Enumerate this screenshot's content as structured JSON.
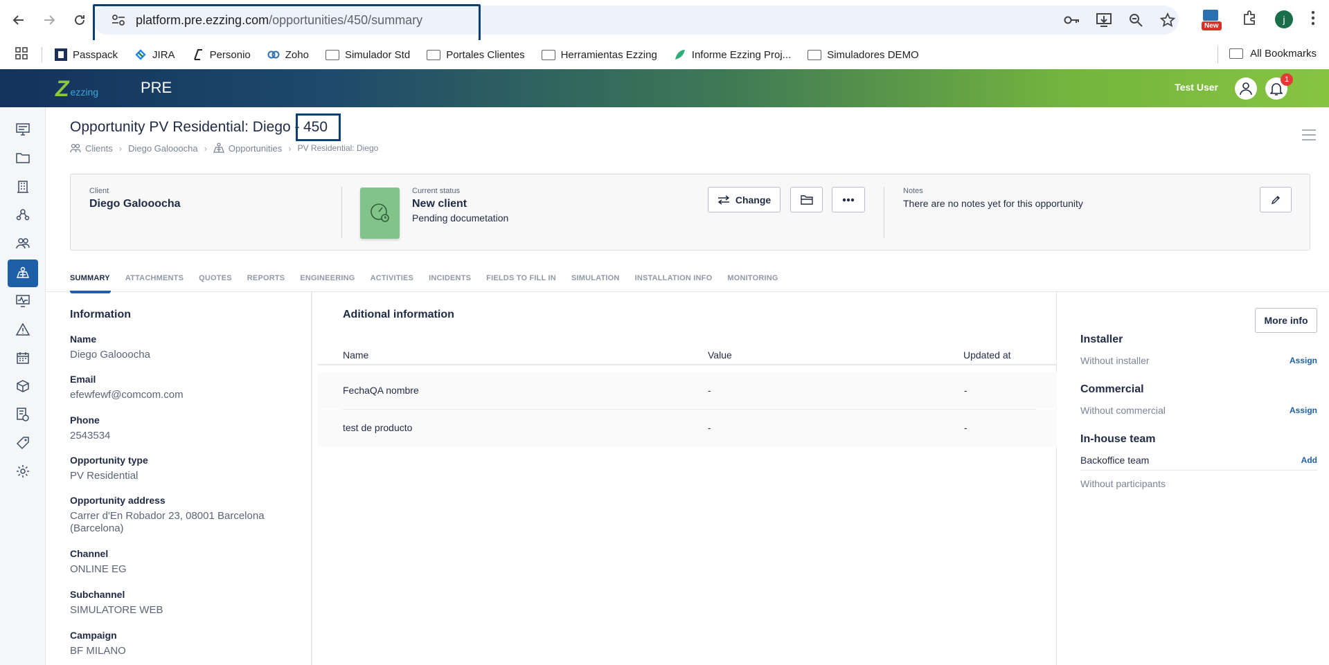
{
  "browser": {
    "url_host": "platform.pre.ezzing.com",
    "url_path": "/opportunities/450/summary",
    "new_badge": "New",
    "profile_initial": "j"
  },
  "bookmarks": {
    "items": [
      "Passpack",
      "JIRA",
      "Personio",
      "Zoho",
      "Simulador Std",
      "Portales Clientes",
      "Herramientas Ezzing",
      "Informe Ezzing Proj...",
      "Simuladores DEMO"
    ],
    "all_label": "All Bookmarks"
  },
  "header": {
    "logo_text": "ezzing",
    "env": "PRE",
    "user_name": "Test User",
    "notification_count": "1"
  },
  "page": {
    "title": "Opportunity PV Residential: Diego -",
    "title_number": "450",
    "breadcrumb": [
      "Clients",
      "Diego Galooocha",
      "Opportunities",
      "PV Residential: Diego"
    ]
  },
  "status_card": {
    "client_label": "Client",
    "client_name": "Diego Galooocha",
    "status_label": "Current status",
    "status_name": "New client",
    "status_sub": "Pending documetation",
    "change_label": "Change",
    "notes_label": "Notes",
    "notes_text": "There are no notes yet for this opportunity"
  },
  "tabs": [
    "SUMMARY",
    "ATTACHMENTS",
    "QUOTES",
    "REPORTS",
    "ENGINEERING",
    "ACTIVITIES",
    "INCIDENTS",
    "FIELDS TO FILL IN",
    "SIMULATION",
    "INSTALLATION INFO",
    "MONITORING"
  ],
  "information": {
    "title": "Information",
    "fields": [
      {
        "label": "Name",
        "value": "Diego Galooocha"
      },
      {
        "label": "Email",
        "value": "efewfewf@comcom.com"
      },
      {
        "label": "Phone",
        "value": "2543534"
      },
      {
        "label": "Opportunity type",
        "value": "PV Residential"
      },
      {
        "label": "Opportunity address",
        "value": "Carrer d'En Robador 23, 08001 Barcelona (Barcelona)"
      },
      {
        "label": "Channel",
        "value": "ONLINE EG"
      },
      {
        "label": "Subchannel",
        "value": "SIMULATORE WEB"
      },
      {
        "label": "Campaign",
        "value": "BF MILANO"
      }
    ]
  },
  "additional": {
    "title": "Aditional information",
    "columns": [
      "Name",
      "Value",
      "Updated at"
    ],
    "rows": [
      [
        "FechaQA nombre",
        "-",
        "-"
      ],
      [
        "test de producto",
        "-",
        "-"
      ]
    ]
  },
  "right": {
    "more_info": "More info",
    "installer_title": "Installer",
    "installer_value": "Without installer",
    "installer_action": "Assign",
    "commercial_title": "Commercial",
    "commercial_value": "Without commercial",
    "commercial_action": "Assign",
    "inhouse_title": "In-house team",
    "backoffice_label": "Backoffice team",
    "backoffice_action": "Add",
    "participants": "Without participants"
  },
  "colors": {
    "primary": "#1d5fa8",
    "status_tile": "#82c38a",
    "highlight_box": "#0b3f77"
  }
}
